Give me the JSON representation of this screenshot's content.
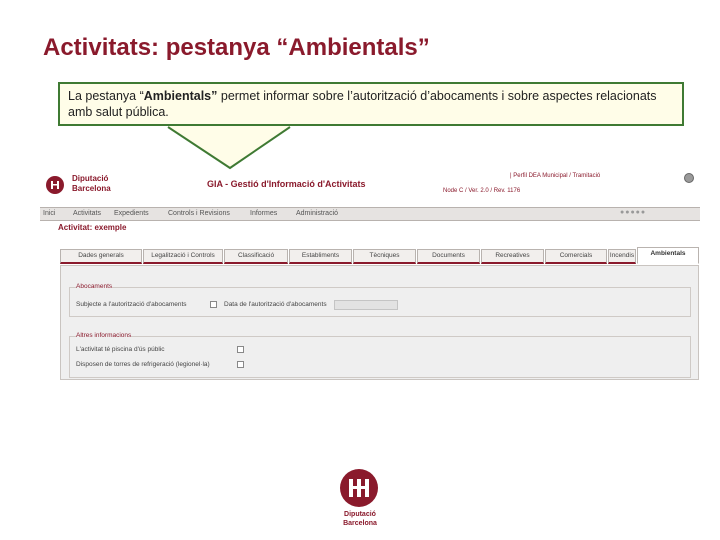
{
  "slide": {
    "title": "Activitats: pestanya “Ambientals”",
    "callout": {
      "before": "La pestanya “",
      "bold": "Ambientals”",
      "after": " permet informar sobre l’autorització d’abocaments i sobre aspectes relacionats amb salut pública."
    }
  },
  "app": {
    "logo_line1": "Diputació",
    "logo_line2": "Barcelona",
    "title": "GIA - Gestió d'Informació d'Activitats",
    "top_links": "| Perfil DEA Municipal / Tramitació",
    "version": "Node C / Ver. 2.0 / Rev. 1176",
    "menu": [
      "Inici",
      "Activitats",
      "Expedients",
      "Controls i Revisions",
      "Informes",
      "Administració"
    ],
    "activity_title": "Activitat: exemple",
    "tabs": [
      "Dades generals",
      "Legalització i Controls",
      "Classificació",
      "Establiments",
      "Tècniques",
      "Documents",
      "Recreatives",
      "Comercials",
      "Incendis",
      "Ambientals"
    ],
    "active_tab": "Ambientals",
    "abocaments": {
      "legend": "Abocaments",
      "subject_label": "Subjecte a l'autorització d'abocaments",
      "date_label": "Data de l'autorització d'abocaments",
      "date_value": ""
    },
    "altres": {
      "legend": "Altres informacions",
      "public_label": "L'activitat té piscina d'ús públic",
      "cooling_label": "Disposen de torres de refrigeració (legionel·la)"
    }
  },
  "footer": {
    "line1": "Diputació",
    "line2": "Barcelona"
  },
  "colors": {
    "brand": "#8a1a2c",
    "callout_border": "#3f7a33",
    "callout_bg": "#fffde8"
  }
}
